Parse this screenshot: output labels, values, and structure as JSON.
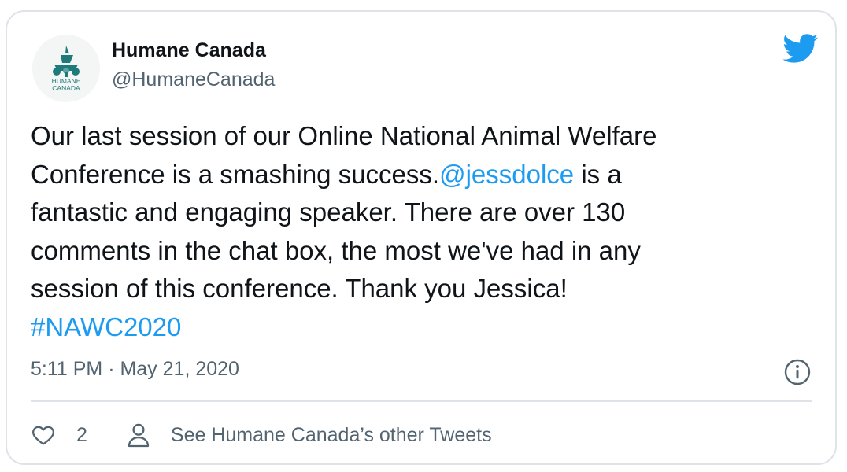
{
  "author": {
    "display_name": "Humane Canada",
    "handle": "@HumaneCanada",
    "logo_text_line1": "HUMANE",
    "logo_text_line2": "CANADA"
  },
  "tweet": {
    "line1": "Our last session of our Online National Animal Welfare",
    "line2_text": "Conference is a smashing success.",
    "mention": "@jessdolce",
    "line2_tail": " is a",
    "line3": "fantastic and engaging speaker. There are over 130",
    "line4": "comments in the chat box, the most we've had in any",
    "line5": "session of this conference. Thank you Jessica!",
    "hashtag": "#NAWC2020"
  },
  "meta": {
    "timestamp": "5:11 PM · May 21, 2020"
  },
  "actions": {
    "like_count": "2",
    "other_tweets_label": "See Humane Canada’s other Tweets"
  },
  "icons": {
    "brand": "twitter-bird-icon",
    "info": "info-icon",
    "like": "heart-icon",
    "profile": "person-icon"
  },
  "colors": {
    "link": "#1d9bf0",
    "logo_teal": "#1f7a7a",
    "text_primary": "#0f1419",
    "text_secondary": "#536471"
  }
}
